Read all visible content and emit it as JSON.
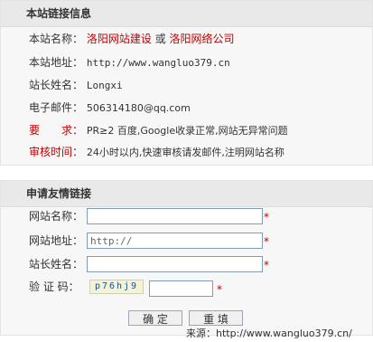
{
  "info": {
    "header": "本站链接信息",
    "rows": [
      {
        "label": "本站名称：",
        "value_part1": "洛阳网站建设",
        "value_mid": " 或 ",
        "value_part2": "洛阳网络公司"
      },
      {
        "label": "本站地址：",
        "value": "http://www.wangluo379.cn"
      },
      {
        "label": "站长姓名：",
        "value": "Longxi"
      },
      {
        "label": "电子邮件：",
        "value": "506314180@qq.com"
      },
      {
        "label": "要　　求：",
        "value": "PR≥2 百度,Google收录正常,网站无异常问题"
      },
      {
        "label": "审核时间：",
        "value": "24小时以内,快速审核请发邮件,注明网站名称"
      }
    ]
  },
  "apply": {
    "header": "申请友情链接",
    "site_name_label": "网站名称：",
    "site_url_label": "网站地址：",
    "site_url_value": "http://",
    "owner_label": "站长姓名：",
    "captcha_label": "验 证 码：",
    "captcha_text": "p76hj9",
    "required_mark": "*",
    "submit_label": "确 定",
    "reset_label": "重 填"
  },
  "source_text": "来源：http://www.wangluo379.cn/",
  "colors": {
    "accent_red": "#c00000"
  }
}
